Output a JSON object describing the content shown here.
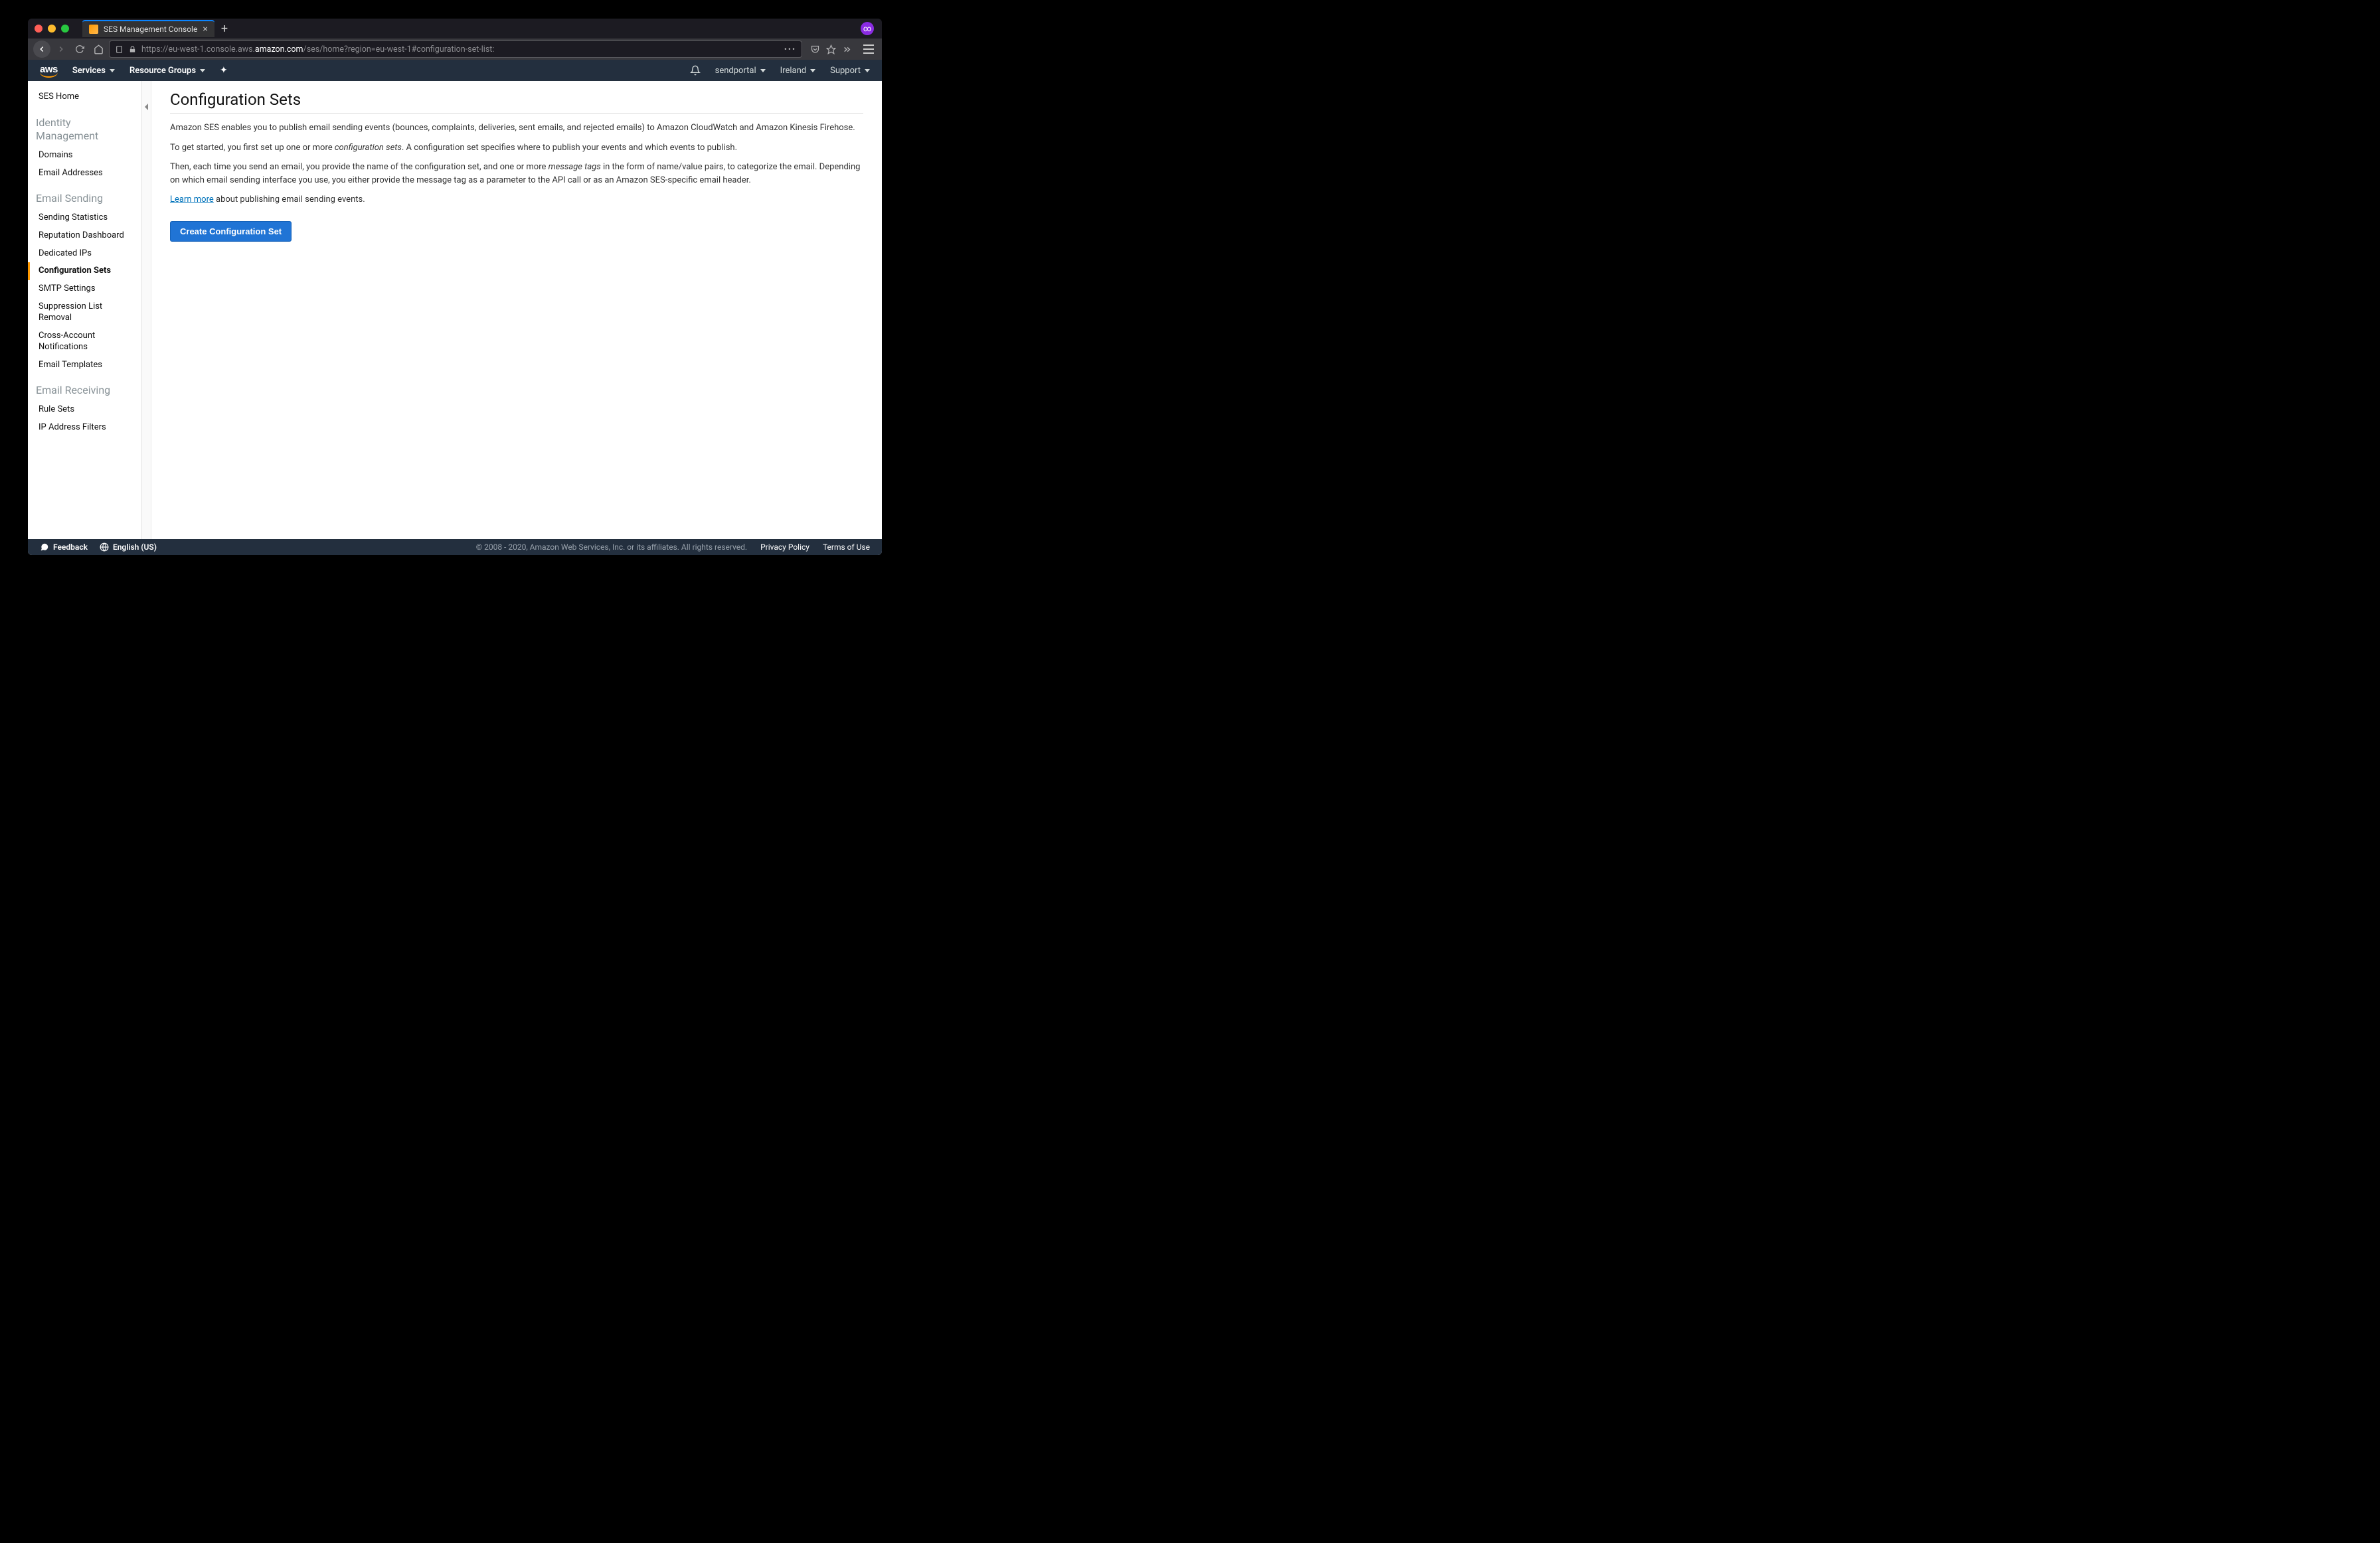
{
  "browser": {
    "tab_title": "SES Management Console",
    "url_prefix": "https://eu-west-1.console.aws.",
    "url_domain": "amazon.com",
    "url_path": "/ses/home?region=eu-west-1#configuration-set-list:"
  },
  "header": {
    "logo": "aws",
    "services": "Services",
    "resource_groups": "Resource Groups",
    "account": "sendportal",
    "region": "Ireland",
    "support": "Support"
  },
  "sidebar": {
    "home": "SES Home",
    "sections": [
      {
        "title": "Identity Management",
        "items": [
          "Domains",
          "Email Addresses"
        ]
      },
      {
        "title": "Email Sending",
        "items": [
          "Sending Statistics",
          "Reputation Dashboard",
          "Dedicated IPs",
          "Configuration Sets",
          "SMTP Settings",
          "Suppression List Removal",
          "Cross-Account Notifications",
          "Email Templates"
        ],
        "active": "Configuration Sets"
      },
      {
        "title": "Email Receiving",
        "items": [
          "Rule Sets",
          "IP Address Filters"
        ]
      }
    ]
  },
  "main": {
    "title": "Configuration Sets",
    "p1": "Amazon SES enables you to publish email sending events (bounces, complaints, deliveries, sent emails, and rejected emails) to Amazon CloudWatch and Amazon Kinesis Firehose.",
    "p2_pre": "To get started, you first set up one or more ",
    "p2_em": "configuration sets",
    "p2_post": ". A configuration set specifies where to publish your events and which events to publish.",
    "p3_pre": "Then, each time you send an email, you provide the name of the configuration set, and one or more ",
    "p3_em": "message tags",
    "p3_post": " in the form of name/value pairs, to categorize the email. Depending on which email sending interface you use, you either provide the message tag as a parameter to the API call or as an Amazon SES-specific email header.",
    "learn_more": "Learn more",
    "learn_more_tail": " about publishing email sending events.",
    "button": "Create Configuration Set"
  },
  "footer": {
    "feedback": "Feedback",
    "language": "English (US)",
    "copyright": "© 2008 - 2020, Amazon Web Services, Inc. or its affiliates. All rights reserved.",
    "privacy": "Privacy Policy",
    "terms": "Terms of Use"
  }
}
